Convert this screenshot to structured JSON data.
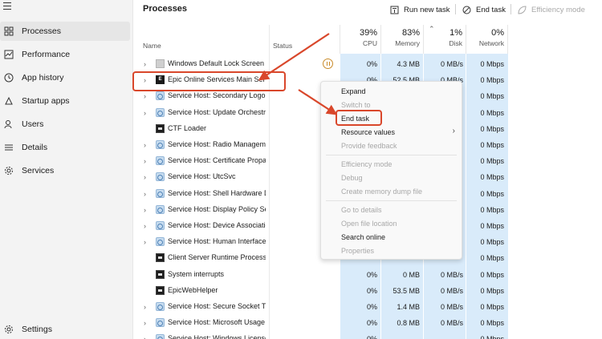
{
  "sidebar": {
    "items": [
      {
        "label": "Processes",
        "icon": "processes-icon",
        "active": true
      },
      {
        "label": "Performance",
        "icon": "performance-icon"
      },
      {
        "label": "App history",
        "icon": "history-icon"
      },
      {
        "label": "Startup apps",
        "icon": "startup-icon"
      },
      {
        "label": "Users",
        "icon": "users-icon"
      },
      {
        "label": "Details",
        "icon": "details-icon"
      },
      {
        "label": "Services",
        "icon": "services-icon"
      }
    ],
    "settings_label": "Settings"
  },
  "header": {
    "title": "Processes",
    "run_new_task": "Run new task",
    "end_task": "End task",
    "efficiency_mode": "Efficiency mode"
  },
  "columns": {
    "name": "Name",
    "status": "Status",
    "cpu": {
      "pct": "39%",
      "label": "CPU"
    },
    "memory": {
      "pct": "83%",
      "label": "Memory"
    },
    "disk": {
      "pct": "1%",
      "label": "Disk"
    },
    "network": {
      "pct": "0%",
      "label": "Network"
    }
  },
  "rows": [
    {
      "name": "Windows Default Lock Screen",
      "icon": "grey",
      "expand": true,
      "cpu": "0%",
      "mem": "4.3 MB",
      "disk": "0 MB/s",
      "net": "0 Mbps",
      "paused": true
    },
    {
      "name": "Epic Online Services Main Service",
      "icon": "epic",
      "expand": true,
      "cpu": "0%",
      "mem": "52.5 MB",
      "disk": "0 MB/s",
      "net": "0 Mbps"
    },
    {
      "name": "Service Host: Secondary Logon",
      "icon": "gear",
      "expand": true,
      "cpu": "",
      "mem": "",
      "disk": "",
      "net": "0 Mbps"
    },
    {
      "name": "Service Host: Update Orchestrator",
      "icon": "gear",
      "expand": true,
      "cpu": "",
      "mem": "",
      "disk": "",
      "net": "0 Mbps"
    },
    {
      "name": "CTF Loader",
      "icon": "win",
      "expand": false,
      "cpu": "",
      "mem": "",
      "disk": "",
      "net": "0 Mbps"
    },
    {
      "name": "Service Host: Radio Management",
      "icon": "gear",
      "expand": true,
      "cpu": "",
      "mem": "",
      "disk": "",
      "net": "0 Mbps"
    },
    {
      "name": "Service Host: Certificate Propagation",
      "icon": "gear",
      "expand": true,
      "cpu": "",
      "mem": "",
      "disk": "",
      "net": "0 Mbps"
    },
    {
      "name": "Service Host: UtcSvc",
      "icon": "gear",
      "expand": true,
      "cpu": "",
      "mem": "",
      "disk": "",
      "net": "0 Mbps"
    },
    {
      "name": "Service Host: Shell Hardware Detection",
      "icon": "gear",
      "expand": true,
      "cpu": "",
      "mem": "",
      "disk": "",
      "net": "0 Mbps"
    },
    {
      "name": "Service Host: Display Policy Service",
      "icon": "gear",
      "expand": true,
      "cpu": "",
      "mem": "",
      "disk": "",
      "net": "0 Mbps"
    },
    {
      "name": "Service Host: Device Association",
      "icon": "gear",
      "expand": true,
      "cpu": "",
      "mem": "",
      "disk": "",
      "net": "0 Mbps"
    },
    {
      "name": "Service Host: Human Interface Device",
      "icon": "gear",
      "expand": true,
      "cpu": "",
      "mem": "",
      "disk": "",
      "net": "0 Mbps"
    },
    {
      "name": "Client Server Runtime Process",
      "icon": "win",
      "expand": false,
      "cpu": "",
      "mem": "",
      "disk": "",
      "net": "0 Mbps"
    },
    {
      "name": "System interrupts",
      "icon": "win",
      "expand": false,
      "cpu": "0%",
      "mem": "0 MB",
      "disk": "0 MB/s",
      "net": "0 Mbps"
    },
    {
      "name": "EpicWebHelper",
      "icon": "win",
      "expand": false,
      "cpu": "0%",
      "mem": "53.5 MB",
      "disk": "0 MB/s",
      "net": "0 Mbps"
    },
    {
      "name": "Service Host: Secure Socket Tunneling",
      "icon": "gear",
      "expand": true,
      "cpu": "0%",
      "mem": "1.4 MB",
      "disk": "0 MB/s",
      "net": "0 Mbps"
    },
    {
      "name": "Service Host: Microsoft Usage Data",
      "icon": "gear",
      "expand": true,
      "cpu": "0%",
      "mem": "0.8 MB",
      "disk": "0 MB/s",
      "net": "0 Mbps"
    },
    {
      "name": "Service Host: Windows License",
      "icon": "gear",
      "expand": true,
      "cpu": "0%",
      "mem": "",
      "disk": "",
      "net": "0 Mbps"
    }
  ],
  "context_menu": {
    "items": [
      {
        "label": "Expand",
        "disabled": false
      },
      {
        "label": "Switch to",
        "disabled": true
      },
      {
        "label": "End task",
        "disabled": false
      },
      {
        "label": "Resource values",
        "disabled": false,
        "submenu": true
      },
      {
        "label": "Provide feedback",
        "disabled": true
      },
      {
        "label": "Efficiency mode",
        "disabled": true
      },
      {
        "label": "Debug",
        "disabled": true
      },
      {
        "label": "Create memory dump file",
        "disabled": true
      },
      {
        "label": "Go to details",
        "disabled": true
      },
      {
        "label": "Open file location",
        "disabled": true
      },
      {
        "label": "Search online",
        "disabled": false
      },
      {
        "label": "Properties",
        "disabled": true
      }
    ]
  },
  "colors": {
    "highlight": "#d9472b",
    "tint": "#d9ebfa"
  }
}
